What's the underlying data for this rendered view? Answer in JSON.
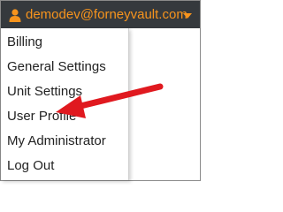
{
  "header": {
    "user_icon": "user-icon",
    "email": "demodev@forneyvault.com",
    "caret_icon": "caret-down-icon",
    "accent_color": "#f7941d",
    "bar_color": "#35393d"
  },
  "menu": {
    "items": [
      {
        "label": "Billing"
      },
      {
        "label": "General Settings"
      },
      {
        "label": "Unit Settings"
      },
      {
        "label": "User Profile"
      },
      {
        "label": "My Administrator"
      },
      {
        "label": "Log Out"
      }
    ]
  },
  "annotation": {
    "arrow_icon": "red-arrow-annotation",
    "arrow_color": "#e0191f"
  }
}
